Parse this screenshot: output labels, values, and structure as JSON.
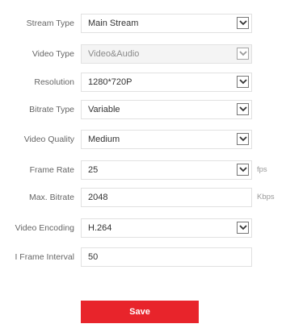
{
  "form": {
    "stream_type": {
      "label": "Stream Type",
      "value": "Main Stream"
    },
    "video_type": {
      "label": "Video Type",
      "value": "Video&Audio"
    },
    "resolution": {
      "label": "Resolution",
      "value": "1280*720P"
    },
    "bitrate_type": {
      "label": "Bitrate Type",
      "value": "Variable"
    },
    "video_quality": {
      "label": "Video Quality",
      "value": "Medium"
    },
    "frame_rate": {
      "label": "Frame Rate",
      "value": "25",
      "unit": "fps"
    },
    "max_bitrate": {
      "label": "Max. Bitrate",
      "value": "2048",
      "unit": "Kbps"
    },
    "video_encoding": {
      "label": "Video Encoding",
      "value": "H.264"
    },
    "i_frame_interval": {
      "label": "I Frame Interval",
      "value": "50"
    }
  },
  "actions": {
    "save_label": "Save",
    "save_color": "#e8242b"
  },
  "icons": {
    "dropdown": "chevron-down-icon"
  }
}
